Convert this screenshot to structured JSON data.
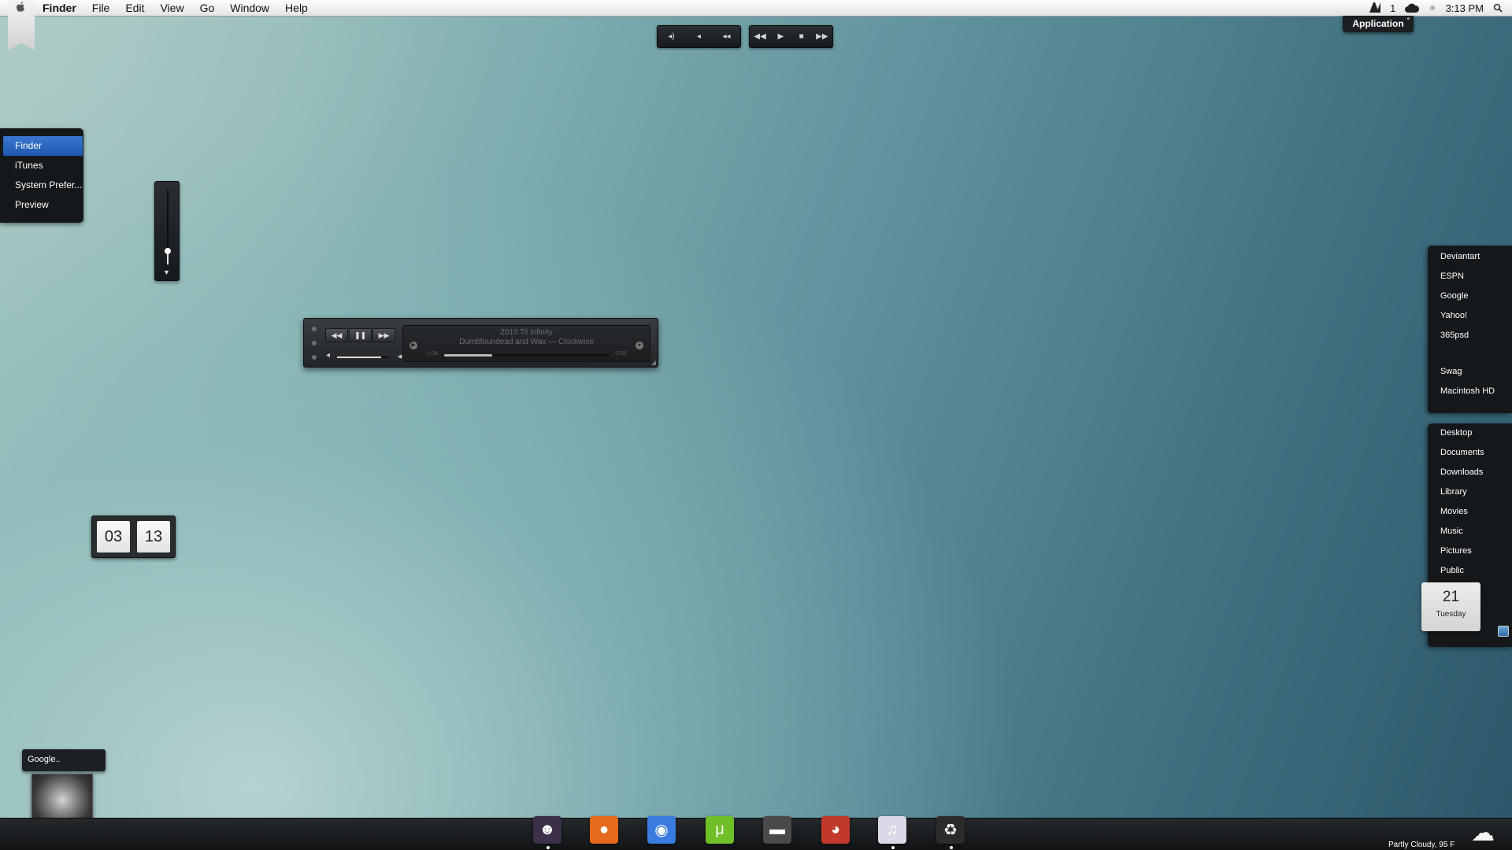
{
  "menubar": {
    "apple": "",
    "app_name": "Finder",
    "menus": [
      "File",
      "Edit",
      "View",
      "Go",
      "Window",
      "Help"
    ],
    "status_counter": "1",
    "time": "3:13 PM",
    "app_badge": "Application"
  },
  "media_controls": {
    "volume_group": [
      "◂)",
      "◂",
      "◂◂"
    ],
    "transport_group": [
      "◀◀",
      "▶",
      "■",
      "▶▶"
    ]
  },
  "app_switcher": {
    "items": [
      "Finder",
      "iTunes",
      "System Prefer...",
      "Preview"
    ],
    "active": "Finder"
  },
  "volume_slider": {
    "level": 0.18
  },
  "player": {
    "album": "2010 Til Infinity",
    "track": "Dumbfoundead and Wax — Clockwise",
    "elapsed": "1:08",
    "remaining": "-2:56",
    "progress": 0.29,
    "volume": 0.85
  },
  "flip_clock": {
    "hour": "03",
    "minute": "13"
  },
  "bookmarks": [
    "Deviantart",
    "ESPN",
    "Google",
    "Yahoo!",
    "365psd",
    "Swag",
    "Macintosh HD"
  ],
  "folders": [
    "Desktop",
    "Documents",
    "Downloads",
    "Library",
    "Movies",
    "Music",
    "Pictures",
    "Public"
  ],
  "calendar": {
    "day": "21",
    "weekday": "Tuesday"
  },
  "search": {
    "text": "Google.."
  },
  "dock": {
    "apps": [
      {
        "name": "Finder",
        "glyph": "☻",
        "color": "#3b2f4a"
      },
      {
        "name": "Firefox",
        "glyph": "●",
        "color": "#e56a1c"
      },
      {
        "name": "Chrome",
        "glyph": "◉",
        "color": "#3a7be0"
      },
      {
        "name": "uTorrent",
        "glyph": "μ",
        "color": "#6fbf28"
      },
      {
        "name": "Drive",
        "glyph": "▬",
        "color": "#4a4a4a"
      },
      {
        "name": "Adium",
        "glyph": "◕",
        "color": "#c0392b"
      },
      {
        "name": "iTunes",
        "glyph": "♫",
        "color": "#d9d9e8"
      },
      {
        "name": "Recycle",
        "glyph": "♻",
        "color": "#2b2b2b"
      }
    ]
  },
  "weather": {
    "text": "Partly Cloudy, 95 F"
  }
}
